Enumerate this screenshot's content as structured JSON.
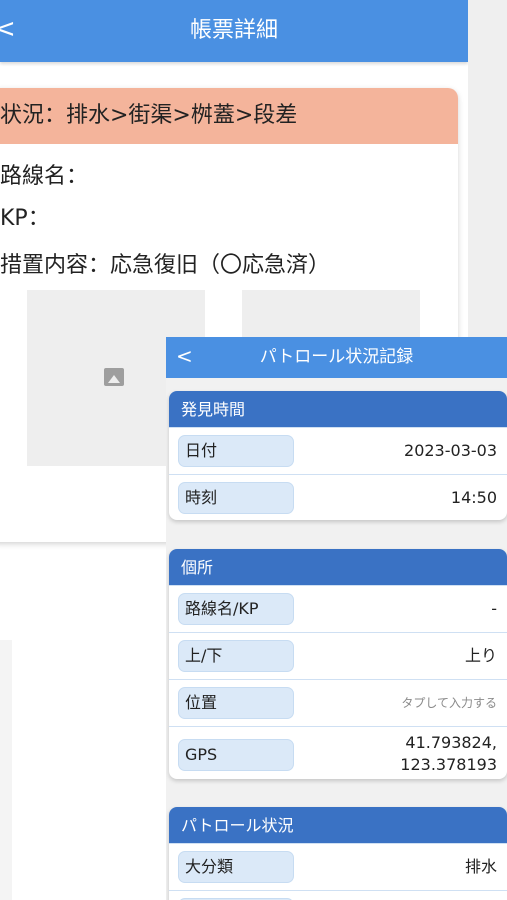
{
  "background_screen": {
    "header": {
      "back_icon": "chevron-left-icon",
      "title": "帳票詳細"
    },
    "card": {
      "status_line": "状況：排水>街渠>桝蓋>段差",
      "route_name_label": "路線名：",
      "kp_label": "KP：",
      "measure_line": "措置内容：応急復旧（〇応急済）",
      "photo_icon": "image-placeholder-icon"
    }
  },
  "foreground_screen": {
    "header": {
      "back_icon": "chevron-left-icon",
      "title": "パトロール状況記録"
    },
    "discovery": {
      "title": "発見時間",
      "date_label": "日付",
      "date_value": "2023-03-03",
      "time_label": "時刻",
      "time_value": "14:50"
    },
    "location": {
      "title": "個所",
      "route_label": "路線名/KP",
      "route_value": "-",
      "direction_label": "上/下",
      "direction_value": "上り",
      "position_label": "位置",
      "position_placeholder": "タプして入力する",
      "gps_label": "GPS",
      "gps_lat": "41.793824,",
      "gps_lon": "123.378193"
    },
    "patrol": {
      "title": "パトロール状況",
      "category_label": "大分類",
      "category_value": "排水"
    }
  },
  "colors": {
    "header_blue": "#4a90e2",
    "section_blue": "#3a72c4",
    "status_salmon": "#f4b49b",
    "label_pill": "#dbe9f8"
  }
}
